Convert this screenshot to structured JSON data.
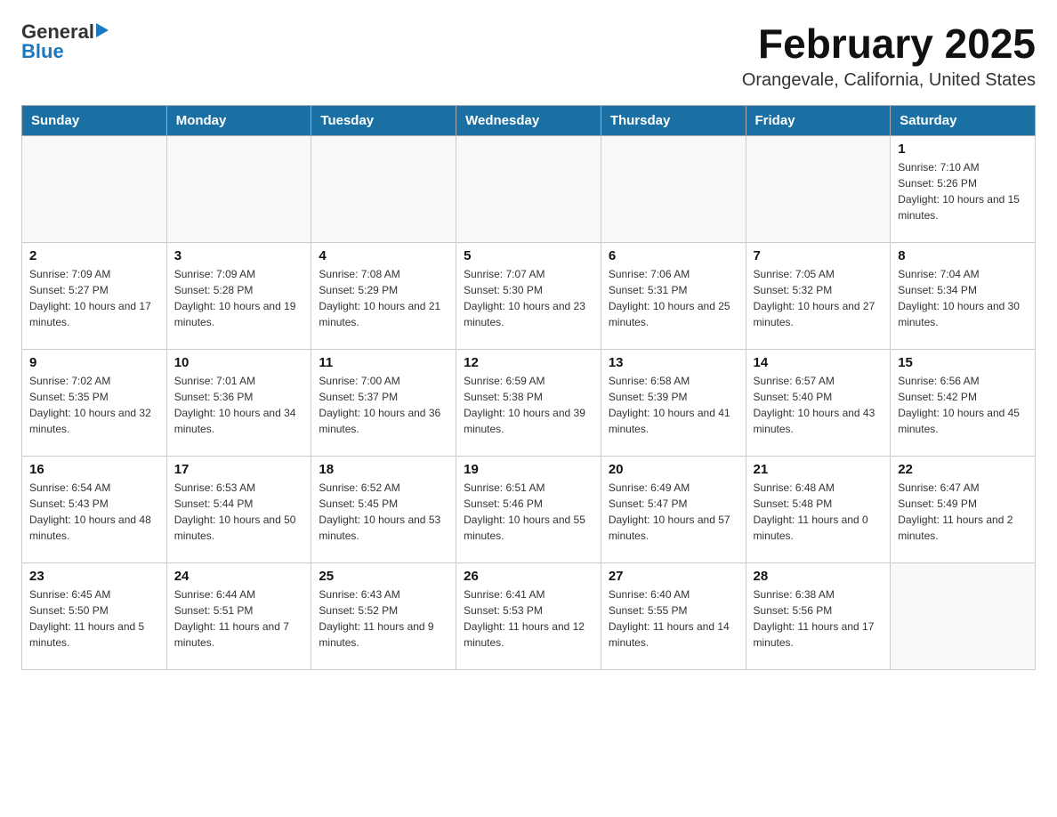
{
  "header": {
    "logo": {
      "general": "General",
      "blue": "Blue"
    },
    "title": "February 2025",
    "location": "Orangevale, California, United States"
  },
  "weekdays": [
    "Sunday",
    "Monday",
    "Tuesday",
    "Wednesday",
    "Thursday",
    "Friday",
    "Saturday"
  ],
  "weeks": [
    [
      {
        "day": "",
        "info": ""
      },
      {
        "day": "",
        "info": ""
      },
      {
        "day": "",
        "info": ""
      },
      {
        "day": "",
        "info": ""
      },
      {
        "day": "",
        "info": ""
      },
      {
        "day": "",
        "info": ""
      },
      {
        "day": "1",
        "info": "Sunrise: 7:10 AM\nSunset: 5:26 PM\nDaylight: 10 hours and 15 minutes."
      }
    ],
    [
      {
        "day": "2",
        "info": "Sunrise: 7:09 AM\nSunset: 5:27 PM\nDaylight: 10 hours and 17 minutes."
      },
      {
        "day": "3",
        "info": "Sunrise: 7:09 AM\nSunset: 5:28 PM\nDaylight: 10 hours and 19 minutes."
      },
      {
        "day": "4",
        "info": "Sunrise: 7:08 AM\nSunset: 5:29 PM\nDaylight: 10 hours and 21 minutes."
      },
      {
        "day": "5",
        "info": "Sunrise: 7:07 AM\nSunset: 5:30 PM\nDaylight: 10 hours and 23 minutes."
      },
      {
        "day": "6",
        "info": "Sunrise: 7:06 AM\nSunset: 5:31 PM\nDaylight: 10 hours and 25 minutes."
      },
      {
        "day": "7",
        "info": "Sunrise: 7:05 AM\nSunset: 5:32 PM\nDaylight: 10 hours and 27 minutes."
      },
      {
        "day": "8",
        "info": "Sunrise: 7:04 AM\nSunset: 5:34 PM\nDaylight: 10 hours and 30 minutes."
      }
    ],
    [
      {
        "day": "9",
        "info": "Sunrise: 7:02 AM\nSunset: 5:35 PM\nDaylight: 10 hours and 32 minutes."
      },
      {
        "day": "10",
        "info": "Sunrise: 7:01 AM\nSunset: 5:36 PM\nDaylight: 10 hours and 34 minutes."
      },
      {
        "day": "11",
        "info": "Sunrise: 7:00 AM\nSunset: 5:37 PM\nDaylight: 10 hours and 36 minutes."
      },
      {
        "day": "12",
        "info": "Sunrise: 6:59 AM\nSunset: 5:38 PM\nDaylight: 10 hours and 39 minutes."
      },
      {
        "day": "13",
        "info": "Sunrise: 6:58 AM\nSunset: 5:39 PM\nDaylight: 10 hours and 41 minutes."
      },
      {
        "day": "14",
        "info": "Sunrise: 6:57 AM\nSunset: 5:40 PM\nDaylight: 10 hours and 43 minutes."
      },
      {
        "day": "15",
        "info": "Sunrise: 6:56 AM\nSunset: 5:42 PM\nDaylight: 10 hours and 45 minutes."
      }
    ],
    [
      {
        "day": "16",
        "info": "Sunrise: 6:54 AM\nSunset: 5:43 PM\nDaylight: 10 hours and 48 minutes."
      },
      {
        "day": "17",
        "info": "Sunrise: 6:53 AM\nSunset: 5:44 PM\nDaylight: 10 hours and 50 minutes."
      },
      {
        "day": "18",
        "info": "Sunrise: 6:52 AM\nSunset: 5:45 PM\nDaylight: 10 hours and 53 minutes."
      },
      {
        "day": "19",
        "info": "Sunrise: 6:51 AM\nSunset: 5:46 PM\nDaylight: 10 hours and 55 minutes."
      },
      {
        "day": "20",
        "info": "Sunrise: 6:49 AM\nSunset: 5:47 PM\nDaylight: 10 hours and 57 minutes."
      },
      {
        "day": "21",
        "info": "Sunrise: 6:48 AM\nSunset: 5:48 PM\nDaylight: 11 hours and 0 minutes."
      },
      {
        "day": "22",
        "info": "Sunrise: 6:47 AM\nSunset: 5:49 PM\nDaylight: 11 hours and 2 minutes."
      }
    ],
    [
      {
        "day": "23",
        "info": "Sunrise: 6:45 AM\nSunset: 5:50 PM\nDaylight: 11 hours and 5 minutes."
      },
      {
        "day": "24",
        "info": "Sunrise: 6:44 AM\nSunset: 5:51 PM\nDaylight: 11 hours and 7 minutes."
      },
      {
        "day": "25",
        "info": "Sunrise: 6:43 AM\nSunset: 5:52 PM\nDaylight: 11 hours and 9 minutes."
      },
      {
        "day": "26",
        "info": "Sunrise: 6:41 AM\nSunset: 5:53 PM\nDaylight: 11 hours and 12 minutes."
      },
      {
        "day": "27",
        "info": "Sunrise: 6:40 AM\nSunset: 5:55 PM\nDaylight: 11 hours and 14 minutes."
      },
      {
        "day": "28",
        "info": "Sunrise: 6:38 AM\nSunset: 5:56 PM\nDaylight: 11 hours and 17 minutes."
      },
      {
        "day": "",
        "info": ""
      }
    ]
  ]
}
